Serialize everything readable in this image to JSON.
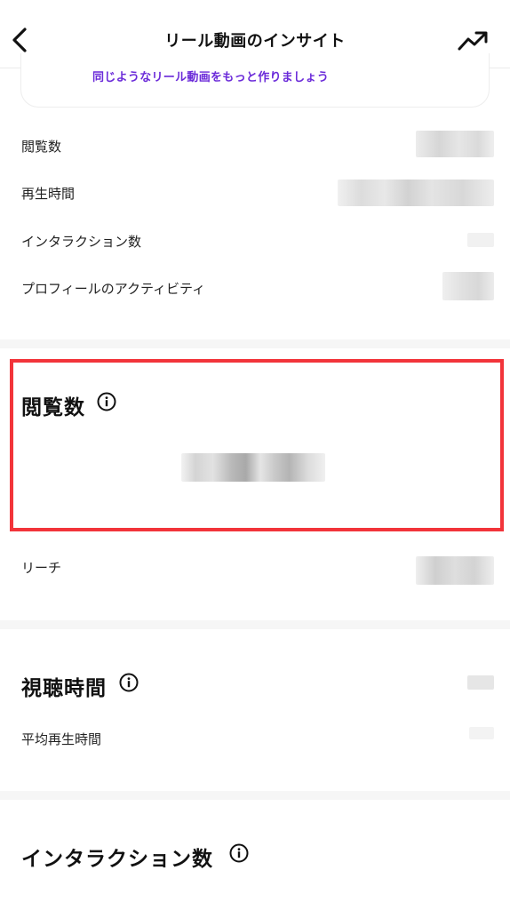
{
  "header": {
    "title": "リール動画のインサイト",
    "back_icon": "chevron-left-icon",
    "trend_icon": "trending-up-icon"
  },
  "promo": {
    "text": "同じようなリール動画をもっと作りましょう",
    "accent": "#6b2bd9"
  },
  "overview": {
    "rows": [
      {
        "label": "閲覧数"
      },
      {
        "label": "再生時間"
      },
      {
        "label": "インタラクション数"
      },
      {
        "label": "プロフィールのアクティビティ"
      }
    ]
  },
  "views_section": {
    "title": "閲覧数",
    "highlight_color": "#f2343a",
    "reach_label": "リーチ"
  },
  "watch_section": {
    "title": "視聴時間",
    "avg_label": "平均再生時間"
  },
  "interaction_section": {
    "title": "インタラクション数"
  }
}
